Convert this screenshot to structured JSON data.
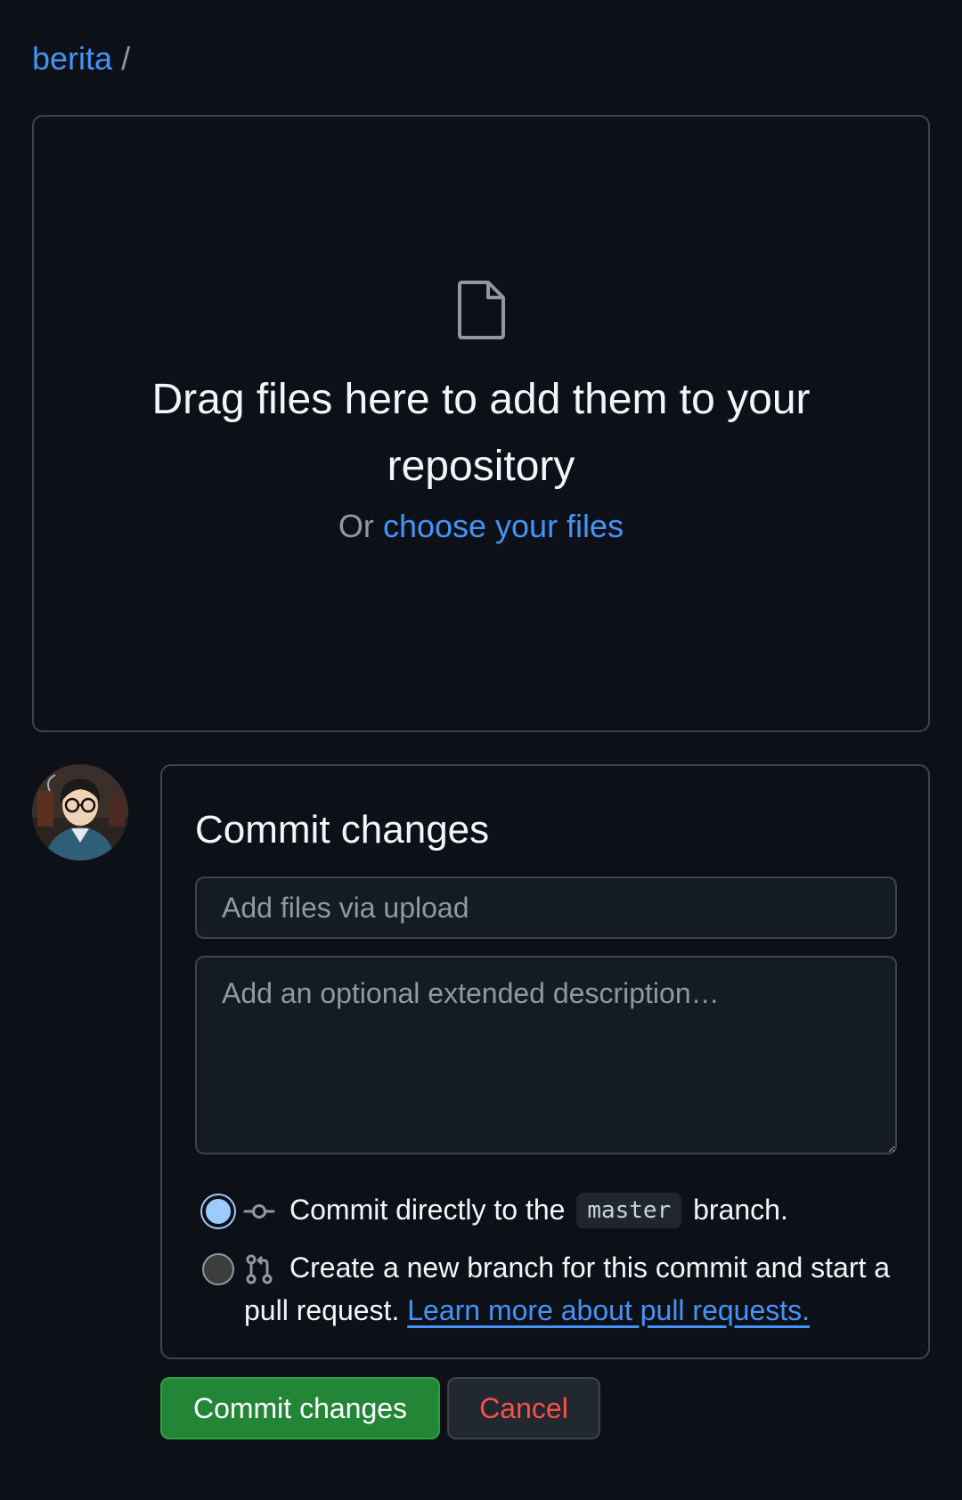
{
  "breadcrumb": {
    "owner": "berita",
    "separator": "/"
  },
  "dropzone": {
    "icon": "file-icon",
    "title": "Drag files here to add them to your repository",
    "sub_prefix": "Or",
    "sub_link": "choose your files"
  },
  "avatar": {
    "icon": "user-avatar"
  },
  "commit": {
    "title": "Commit changes",
    "summary_placeholder": "Add files via upload",
    "description_placeholder": "Add an optional extended description…",
    "option_direct": {
      "selected": true,
      "icon": "git-commit-icon",
      "text_before": "Commit directly to the",
      "branch": "master",
      "text_after": "branch."
    },
    "option_new_branch": {
      "selected": false,
      "icon": "git-pull-request-icon",
      "text_line1": "Create a new branch for this commit and start a",
      "text_line2": "pull request.",
      "link": "Learn more about pull requests."
    }
  },
  "actions": {
    "commit_label": "Commit changes",
    "cancel_label": "Cancel"
  },
  "colors": {
    "background": "#0d1117",
    "link": "#4493f8",
    "primary_button": "#238636",
    "danger_text": "#f85149",
    "border": "#3d444d"
  }
}
